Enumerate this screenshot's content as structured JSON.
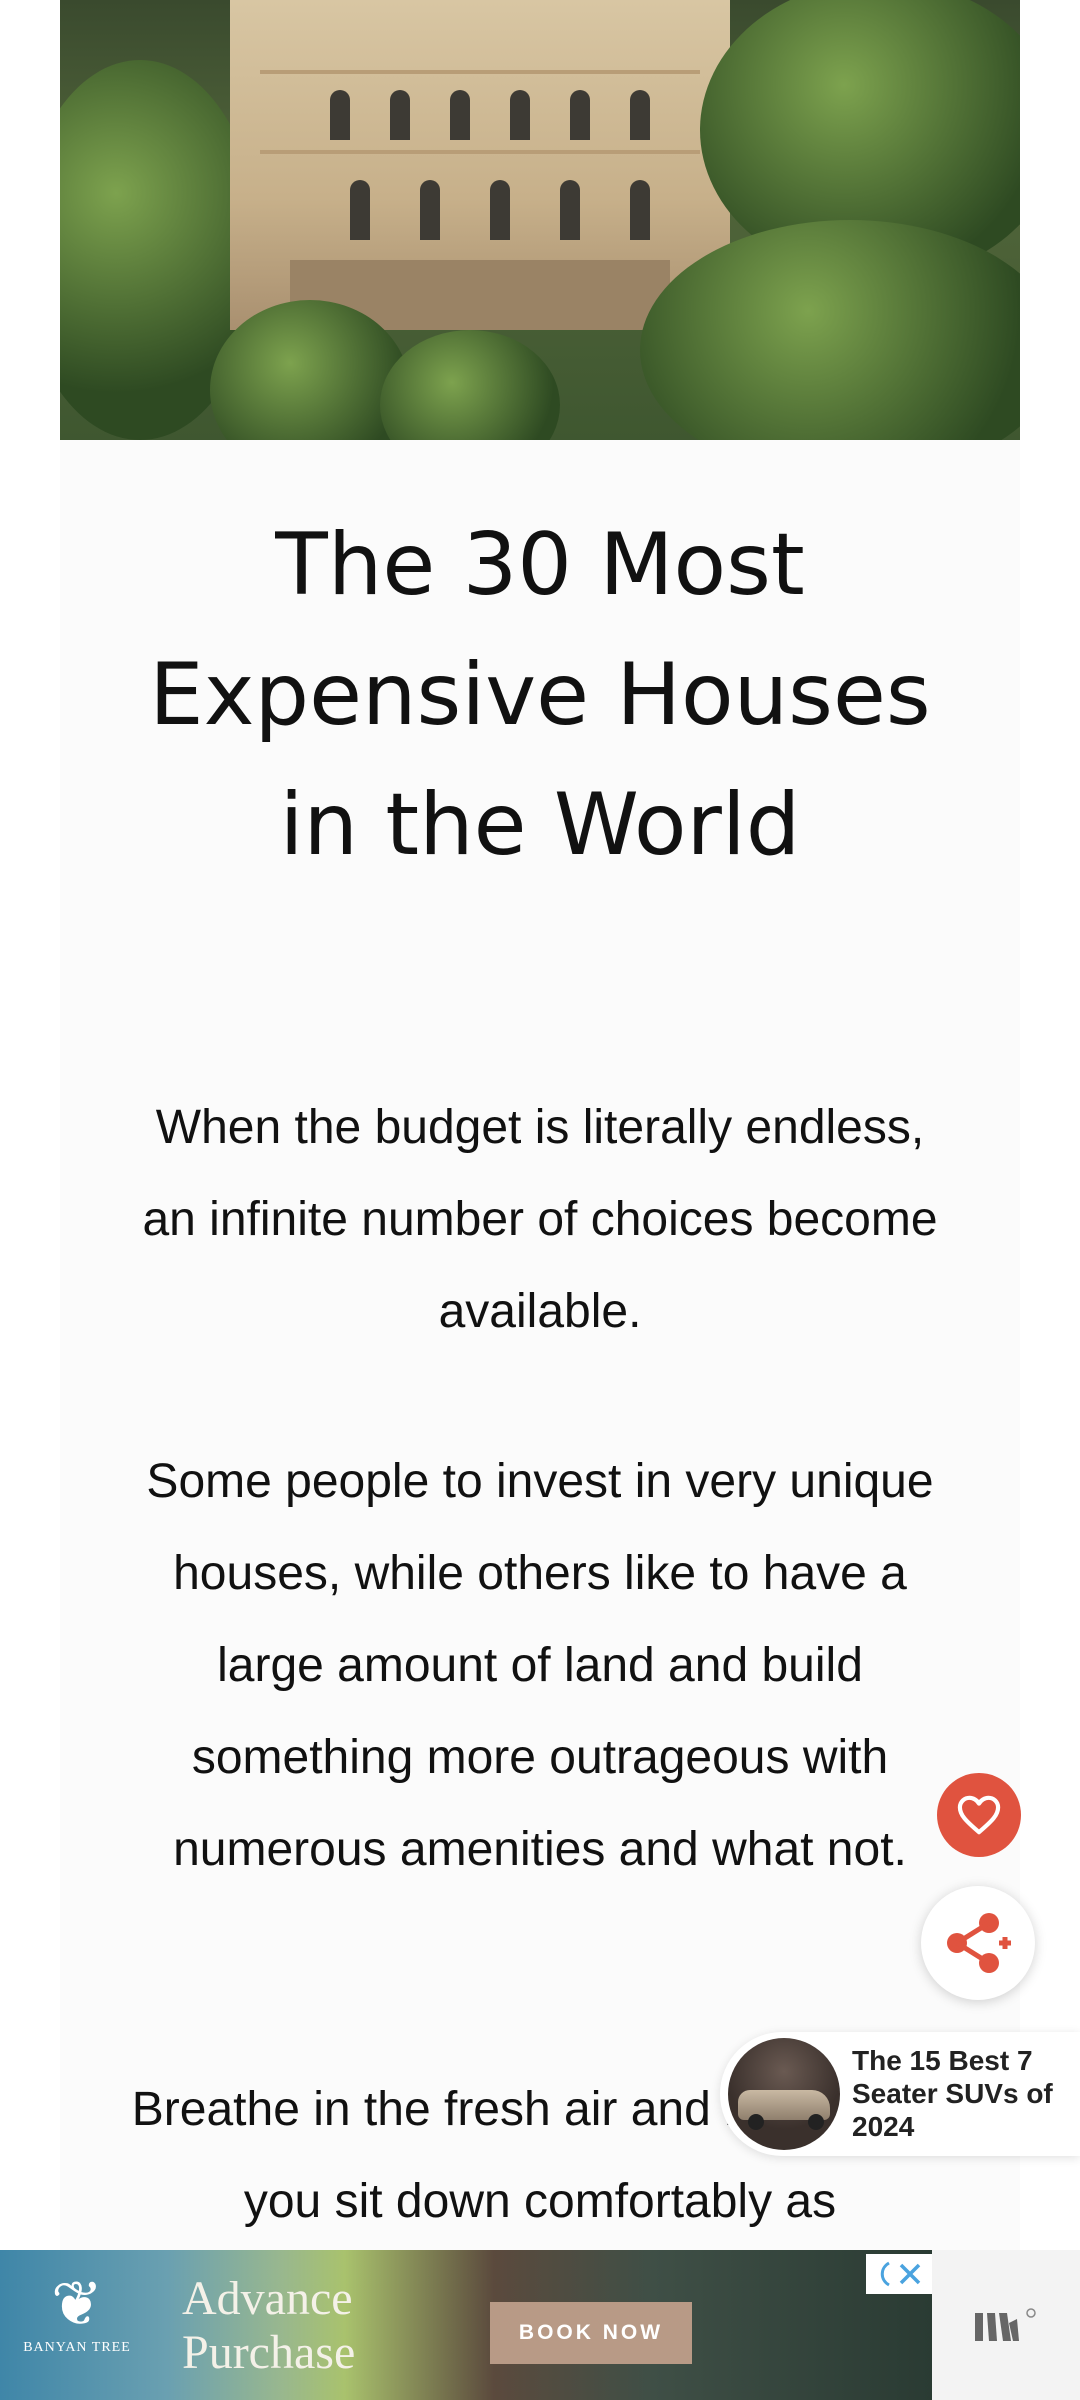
{
  "article": {
    "title": "The 30 Most Expensive Houses in the World",
    "paragraphs": [
      "When the budget is literally endless, an infinite number of choices become available.",
      "Some people to invest in very unique houses, while others like to have a large amount of land and build something more outrageous with numerous amenities and what not.",
      "Breathe in the fresh air and make sure you sit down comfortably as"
    ]
  },
  "floating_actions": {
    "favorite_icon": "heart-icon",
    "share_icon": "share-icon"
  },
  "promo": {
    "text": "The 15 Best 7 Seater SUVs of 2024"
  },
  "ad": {
    "brand": "BANYAN TREE",
    "headline": "Advance Purchase",
    "cta": "BOOK NOW"
  },
  "colors": {
    "accent": "#e0533f",
    "text": "#111111",
    "card_background": "#fbfbfb"
  }
}
